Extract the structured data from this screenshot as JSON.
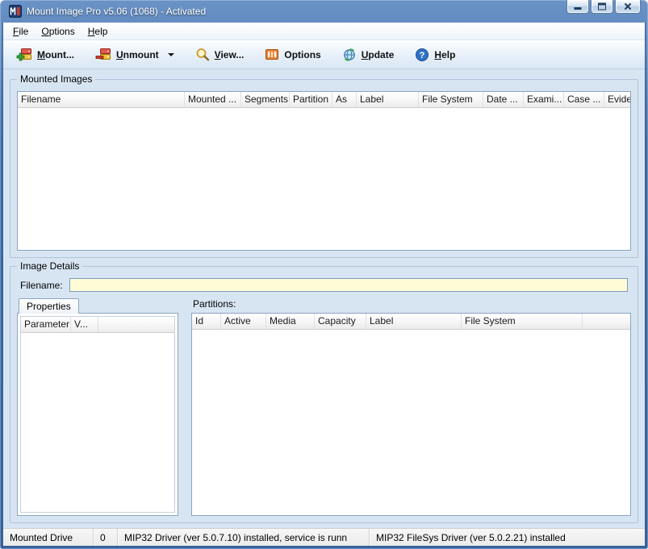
{
  "colors": {
    "titlebar_blue": "#3a69a8",
    "content_bg": "#d7e5f3",
    "filename_field_bg": "#fffbd6",
    "status_bg": "#f0f0f0"
  },
  "window": {
    "title": "Mount Image Pro v5.06 (1068) - Activated"
  },
  "menu": {
    "items": [
      {
        "label": "File",
        "accel": "F",
        "rest": "ile"
      },
      {
        "label": "Options",
        "accel": "O",
        "rest": "ptions"
      },
      {
        "label": "Help",
        "accel": "H",
        "rest": "elp"
      }
    ]
  },
  "toolbar": {
    "buttons": [
      {
        "label": "Mount...",
        "accel": "M",
        "rest": "ount...",
        "icon": "mount-icon"
      },
      {
        "label": "Unmount",
        "accel": "U",
        "rest": "nmount",
        "icon": "unmount-icon",
        "has_dropdown": true
      },
      {
        "label": "View...",
        "accel": "V",
        "rest": "iew...",
        "icon": "view-icon"
      },
      {
        "label": "Options",
        "accel": "",
        "rest": "Options",
        "icon": "options-icon"
      },
      {
        "label": "Update",
        "accel": "U",
        "rest": "pdate",
        "icon": "update-icon"
      },
      {
        "label": "Help",
        "accel": "H",
        "rest": "elp",
        "icon": "help-icon"
      }
    ]
  },
  "mounted_images": {
    "group_label": "Mounted Images",
    "columns": [
      "Filename",
      "Mounted ...",
      "Segments",
      "Partition",
      "As",
      "Label",
      "File System",
      "Date ...",
      "Exami...",
      "Case ...",
      "Evide..."
    ],
    "rows": []
  },
  "image_details": {
    "group_label": "Image Details",
    "filename_label": "Filename:",
    "filename_value": "",
    "properties_tab_label": "Properties",
    "properties_columns": [
      "Parameter",
      "V..."
    ],
    "properties_rows": [],
    "partitions_label": "Partitions:",
    "partitions_columns": [
      "Id",
      "Active",
      "Media",
      "Capacity",
      "Label",
      "File System"
    ],
    "partitions_rows": []
  },
  "status_bar": {
    "sections": [
      "Mounted Drive",
      "0",
      "MIP32 Driver (ver 5.0.7.10) installed, service is runn",
      "MIP32 FileSys Driver (ver 5.0.2.21) installed"
    ]
  }
}
